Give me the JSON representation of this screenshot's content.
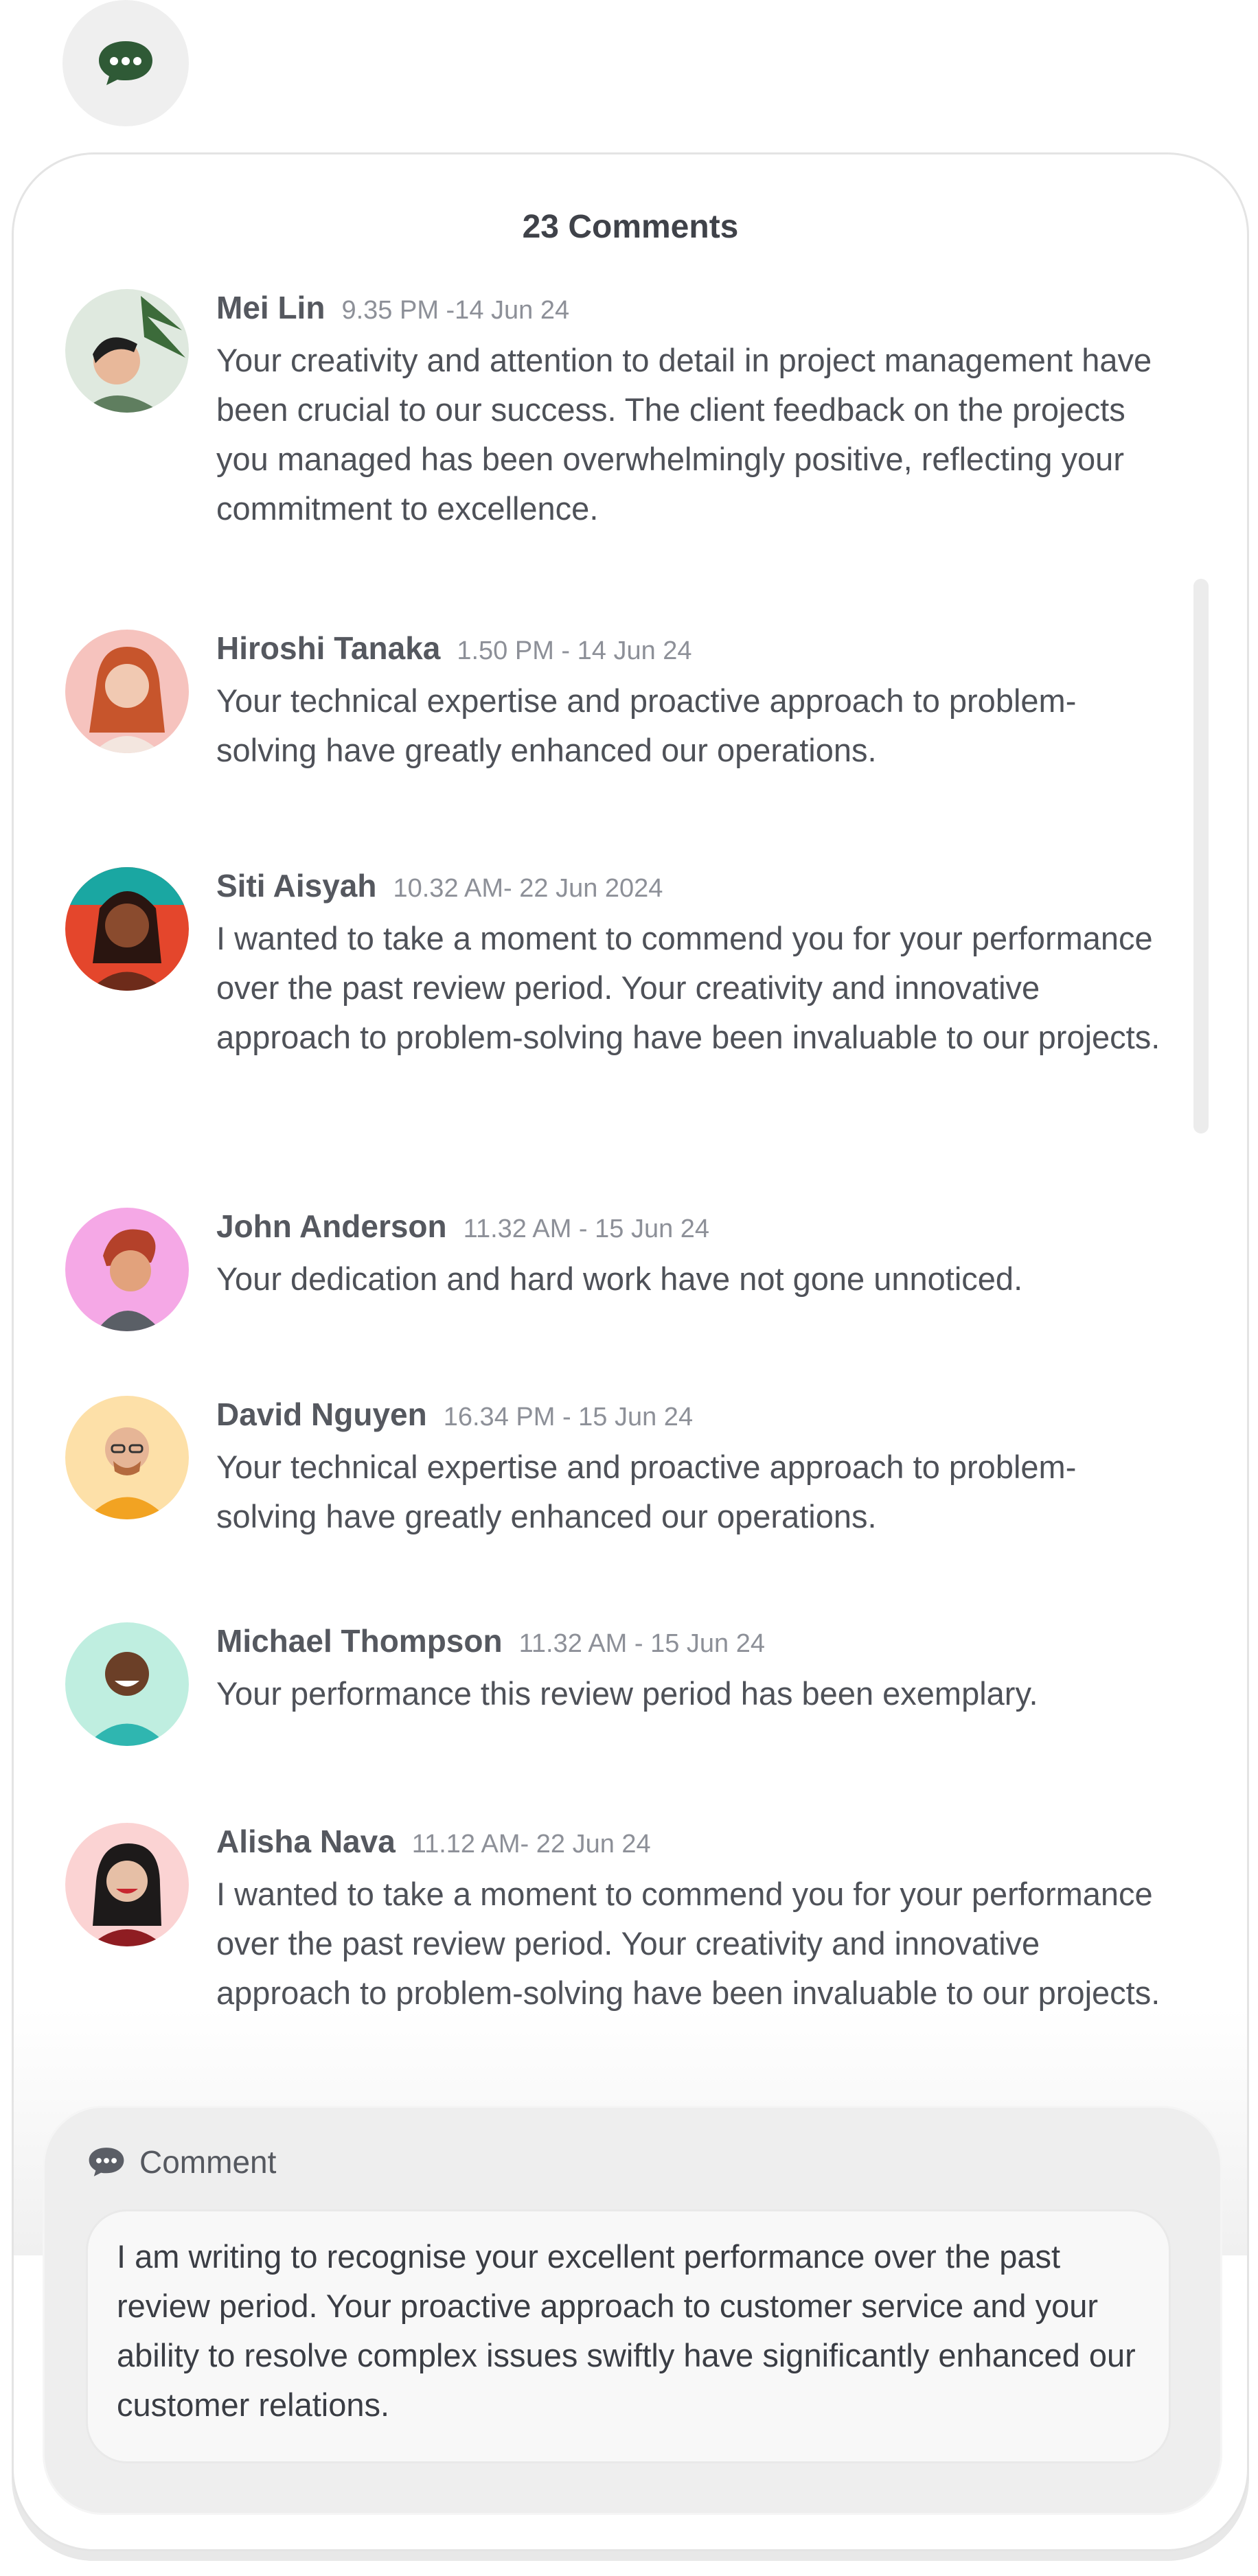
{
  "header": {
    "icon": "chat-bubble-icon",
    "accent": "#2f5a36"
  },
  "panel": {
    "title": "23 Comments"
  },
  "comments": [
    {
      "name": "Mei Lin",
      "time": "9.35 PM -14 Jun 24",
      "text": "Your creativity and attention to detail in project management have been crucial to our success. The client feedback on the projects you managed has been overwhelmingly positive, reflecting your commitment to excellence.",
      "avatar_bg": "#dfe9df"
    },
    {
      "name": "Hiroshi Tanaka",
      "time": "1.50 PM - 14 Jun 24",
      "text": "Your technical expertise and proactive approach to problem-solving have greatly enhanced our operations.",
      "avatar_bg": "#f6c3be"
    },
    {
      "name": "Siti Aisyah",
      "time": "10.32 AM- 22 Jun 2024",
      "text": "I wanted to take a moment to commend you for your performance over the past review period. Your creativity and innovative approach to problem-solving have been invaluable to our projects.",
      "avatar_bg": "#e4462c"
    },
    {
      "name": "John Anderson",
      "time": "11.32 AM - 15 Jun 24",
      "text": "Your dedication and hard work have not gone unnoticed.",
      "avatar_bg": "#f5a8e6"
    },
    {
      "name": "David Nguyen",
      "time": "16.34 PM - 15 Jun 24",
      "text": "Your technical expertise and proactive approach to problem-solving have greatly enhanced our operations.",
      "avatar_bg": "#fde0a8"
    },
    {
      "name": "Michael Thompson",
      "time": "11.32 AM - 15 Jun 24",
      "text": "Your performance this review period has been exemplary.",
      "avatar_bg": "#bfeee0"
    },
    {
      "name": "Alisha Nava",
      "time": "11.12 AM- 22 Jun 24",
      "text": "I wanted to take a moment to commend you for your performance over the past review period. Your creativity and innovative approach to problem-solving have been invaluable to our projects.",
      "avatar_bg": "#fbd3d3"
    }
  ],
  "composer": {
    "icon": "chat-bubble-icon",
    "label": "Comment",
    "value": "I am writing to recognise your excellent performance over the past review period. Your proactive approach to customer service and your ability to resolve complex issues swiftly have significantly enhanced our customer relations."
  }
}
